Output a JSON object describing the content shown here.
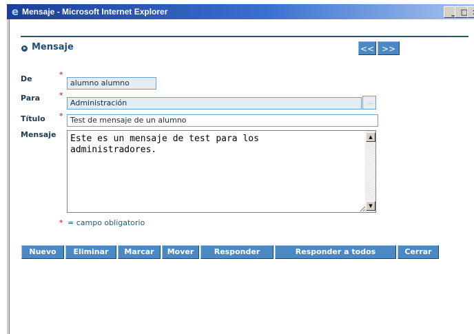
{
  "window": {
    "title": "Mensaje - Microsoft Internet Explorer",
    "icon": "ie-icon",
    "min_glyph": "_",
    "max_glyph": "□",
    "close_glyph": "x"
  },
  "page": {
    "heading": "Mensaje",
    "nav": {
      "prev_label": "<<",
      "next_label": ">>"
    }
  },
  "form": {
    "required_mark": "*",
    "de": {
      "label": "De",
      "value": "alumno alumno"
    },
    "para": {
      "label": "Para",
      "value": "Administración",
      "browse_label": "..."
    },
    "titulo": {
      "label": "Título",
      "value": "Test de mensaje de un alumno"
    },
    "mensaje": {
      "label": "Mensaje",
      "value": "Este es un mensaje de test para los\nadministradores."
    },
    "legend_star": "*",
    "legend": "= campo obligatorio"
  },
  "actions": {
    "nuevo": "Nuevo",
    "eliminar": "Eliminar",
    "marcar": "Marcar",
    "mover": "Mover",
    "responder": "Responder",
    "responder_todos": "Responder a todos",
    "cerrar": "Cerrar"
  },
  "colors": {
    "accent": "#4b89c4",
    "heading": "#1f4e79",
    "required": "#e00000",
    "title_bar": "#1c3f94"
  }
}
